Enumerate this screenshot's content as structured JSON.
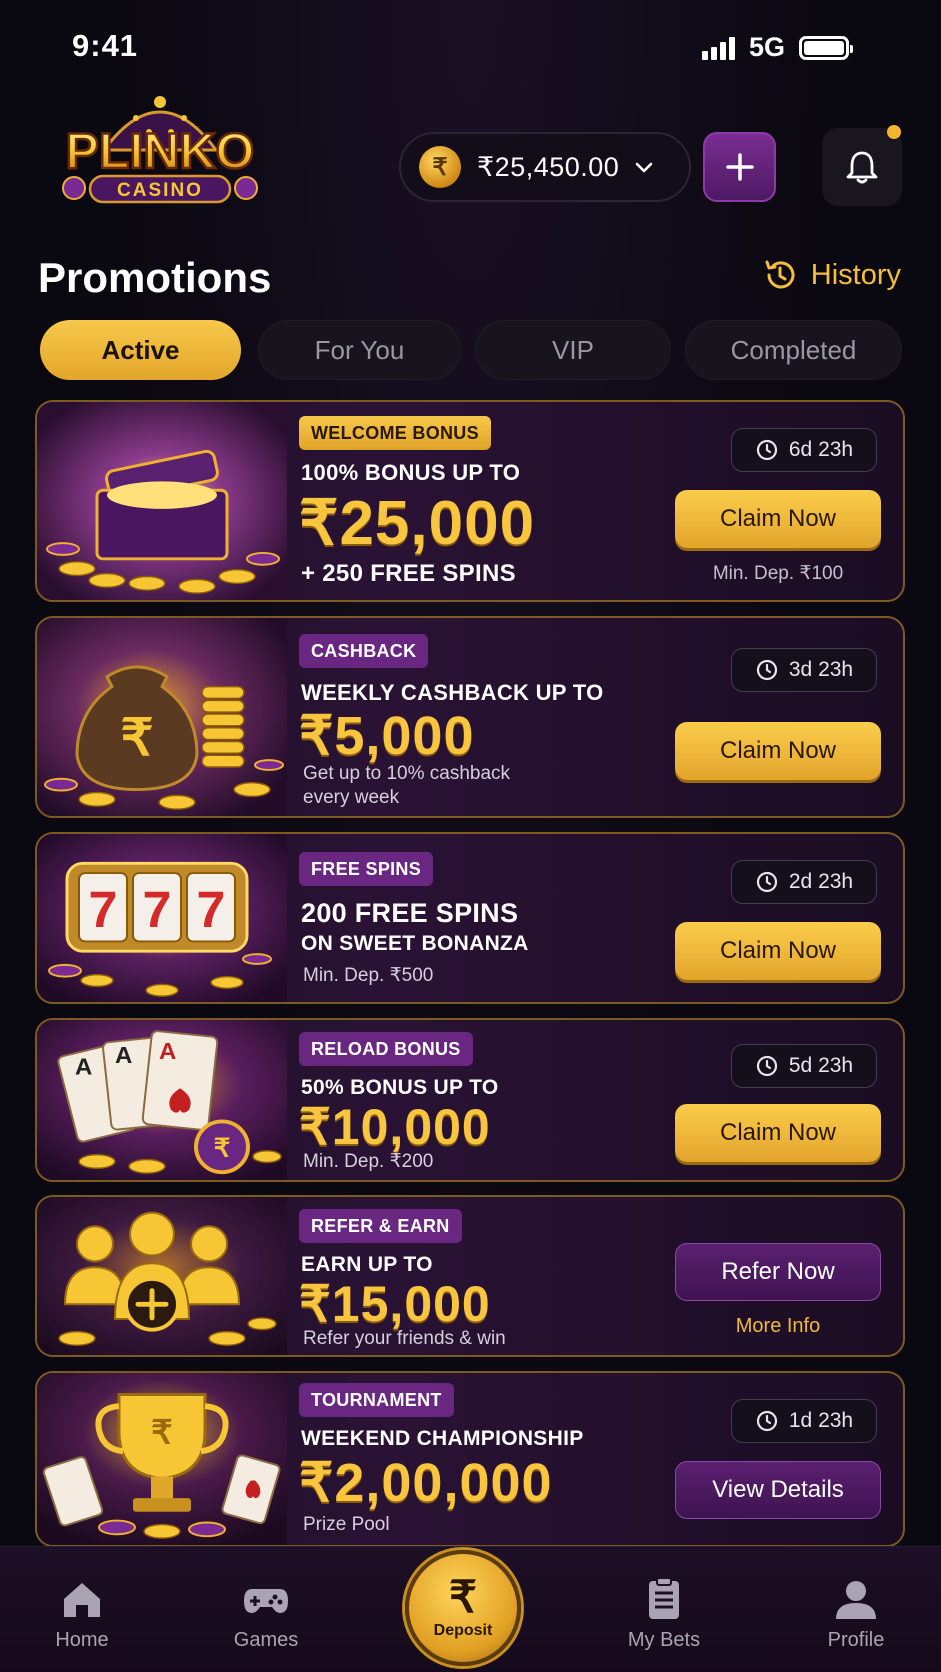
{
  "status": {
    "time": "9:41",
    "network": "5G"
  },
  "header": {
    "logo_text": "PLINKO",
    "logo_subtext": "CASINO",
    "balance": "₹25,450.00",
    "coin_symbol": "₹"
  },
  "page": {
    "title": "Promotions",
    "history_label": "History"
  },
  "tabs": [
    {
      "label": "Active",
      "active": true
    },
    {
      "label": "For You",
      "active": false
    },
    {
      "label": "VIP",
      "active": false
    },
    {
      "label": "Completed",
      "active": false
    }
  ],
  "promos": [
    {
      "badge": "WELCOME BONUS",
      "subtitle": "100% BONUS UP TO",
      "amount": "₹25,000",
      "extra": "+ 250 FREE SPINS",
      "timer": "6d 23h",
      "button": "Claim Now",
      "min_dep": "Min. Dep. ₹100"
    },
    {
      "badge": "CASHBACK",
      "subtitle": "WEEKLY CASHBACK UP TO",
      "amount": "₹5,000",
      "note": "Get up to 10% cashback every week",
      "timer": "3d 23h",
      "button": "Claim Now"
    },
    {
      "badge": "FREE SPINS",
      "subtitle": "200 FREE SPINS",
      "subtitle2": "ON SWEET BONANZA",
      "note": "Min. Dep. ₹500",
      "timer": "2d 23h",
      "button": "Claim Now"
    },
    {
      "badge": "RELOAD BONUS",
      "subtitle": "50% BONUS UP TO",
      "amount": "₹10,000",
      "note": "Min. Dep. ₹200",
      "timer": "5d 23h",
      "button": "Claim Now"
    },
    {
      "badge": "REFER & EARN",
      "subtitle": "EARN UP TO",
      "amount": "₹15,000",
      "note": "Refer your friends & win",
      "button": "Refer Now",
      "more": "More Info"
    },
    {
      "badge": "TOURNAMENT",
      "subtitle": "WEEKEND CHAMPIONSHIP",
      "amount": "₹2,00,000",
      "note": "Prize Pool",
      "timer": "1d 23h",
      "button": "View Details"
    }
  ],
  "nav": {
    "home": "Home",
    "games": "Games",
    "deposit": "Deposit",
    "deposit_symbol": "₹",
    "my_bets": "My Bets",
    "profile": "Profile"
  },
  "colors": {
    "accent_gold": "#f5be3b",
    "accent_purple": "#6a2782",
    "background": "#0a0810"
  }
}
